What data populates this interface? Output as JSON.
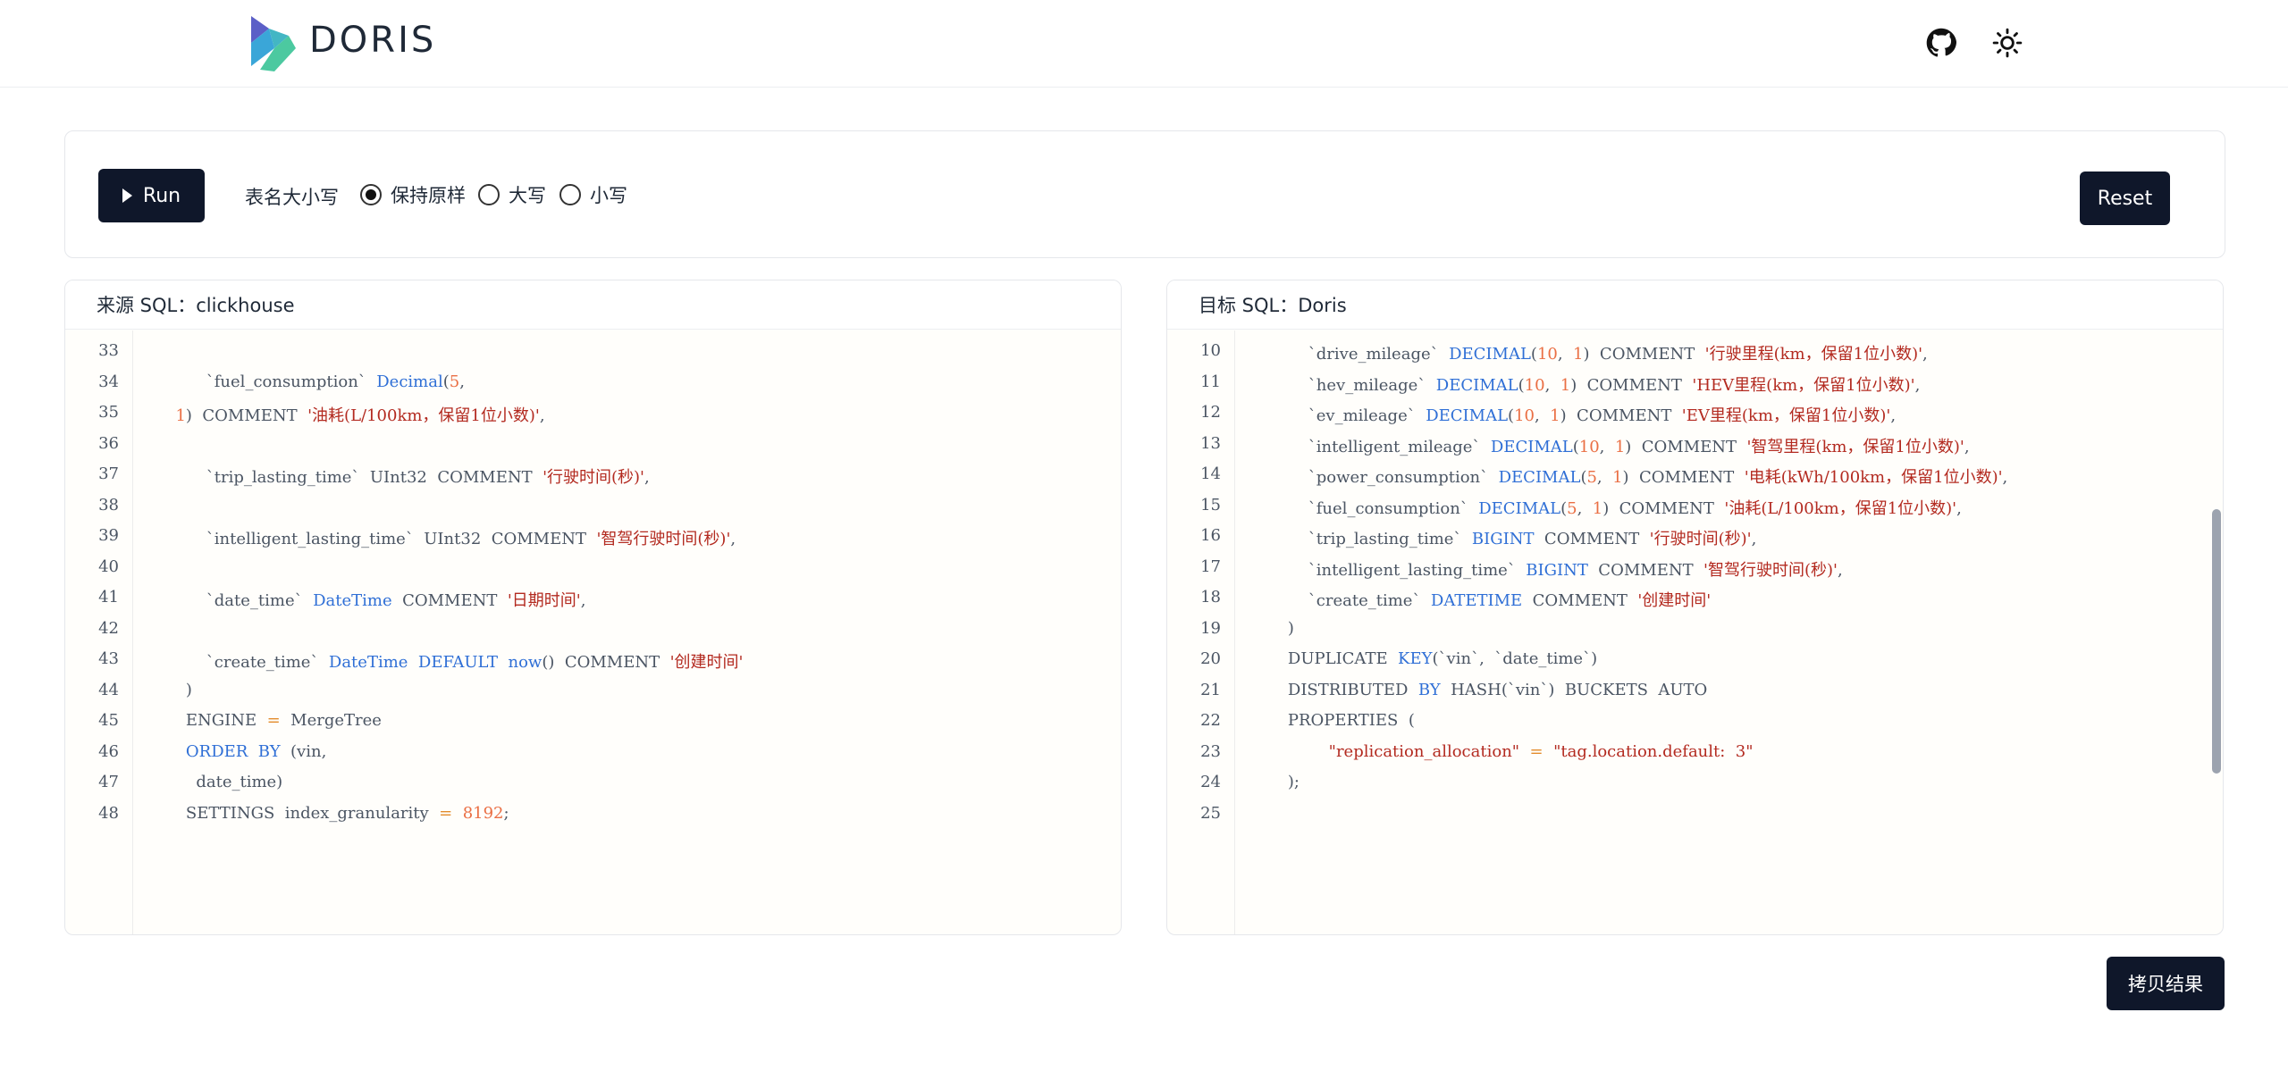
{
  "header": {
    "brand": "DORIS",
    "icons": [
      "github-icon",
      "sun-icon"
    ]
  },
  "toolbar": {
    "run_label": "Run",
    "case_label": "表名大小写",
    "case_options": [
      {
        "label": "保持原样",
        "checked": true
      },
      {
        "label": "大写",
        "checked": false
      },
      {
        "label": "小写",
        "checked": false
      }
    ],
    "reset_label": "Reset"
  },
  "source": {
    "title": "来源 SQL：clickhouse",
    "lines": [
      {
        "n": "33",
        "text": ""
      },
      {
        "n": "34",
        "text": "        `fuel_consumption`  Decimal(5,"
      },
      {
        "n": "35",
        "text": "  1)  COMMENT  '油耗(L/100km，保留1位小数)',"
      },
      {
        "n": "36",
        "text": ""
      },
      {
        "n": "37",
        "text": "        `trip_lasting_time`  UInt32  COMMENT  '行驶时间(秒)',"
      },
      {
        "n": "38",
        "text": ""
      },
      {
        "n": "39",
        "text": "        `intelligent_lasting_time`  UInt32  COMMENT  '智驾行驶时间(秒)',"
      },
      {
        "n": "40",
        "text": ""
      },
      {
        "n": "41",
        "text": "        `date_time`  DateTime  COMMENT  '日期时间',"
      },
      {
        "n": "42",
        "text": ""
      },
      {
        "n": "43",
        "text": "        `create_time`  DateTime  DEFAULT  now()  COMMENT  '创建时间'"
      },
      {
        "n": "44",
        "text": "    )"
      },
      {
        "n": "45",
        "text": "    ENGINE  =  MergeTree"
      },
      {
        "n": "46",
        "text": "    ORDER  BY  (vin,"
      },
      {
        "n": "47",
        "text": "      date_time)"
      },
      {
        "n": "48",
        "text": "    SETTINGS  index_granularity  =  8192;"
      }
    ]
  },
  "target": {
    "title": "目标 SQL：Doris",
    "lines": [
      {
        "n": "10",
        "text": "        `drive_mileage`  DECIMAL(10,  1)  COMMENT  '行驶里程(km，保留1位小数)',"
      },
      {
        "n": "11",
        "text": "        `hev_mileage`  DECIMAL(10,  1)  COMMENT  'HEV里程(km，保留1位小数)',"
      },
      {
        "n": "12",
        "text": "        `ev_mileage`  DECIMAL(10,  1)  COMMENT  'EV里程(km，保留1位小数)',"
      },
      {
        "n": "13",
        "text": "        `intelligent_mileage`  DECIMAL(10,  1)  COMMENT  '智驾里程(km，保留1位小数)',"
      },
      {
        "n": "14",
        "text": "        `power_consumption`  DECIMAL(5,  1)  COMMENT  '电耗(kWh/100km，保留1位小数)',"
      },
      {
        "n": "15",
        "text": "        `fuel_consumption`  DECIMAL(5,  1)  COMMENT  '油耗(L/100km，保留1位小数)',"
      },
      {
        "n": "16",
        "text": "        `trip_lasting_time`  BIGINT  COMMENT  '行驶时间(秒)',"
      },
      {
        "n": "17",
        "text": "        `intelligent_lasting_time`  BIGINT  COMMENT  '智驾行驶时间(秒)',"
      },
      {
        "n": "18",
        "text": "        `create_time`  DATETIME  COMMENT  '创建时间'"
      },
      {
        "n": "19",
        "text": "    )"
      },
      {
        "n": "20",
        "text": "    DUPLICATE  KEY(`vin`,  `date_time`)"
      },
      {
        "n": "21",
        "text": "    DISTRIBUTED  BY  HASH(`vin`)  BUCKETS  AUTO"
      },
      {
        "n": "22",
        "text": "    PROPERTIES  ("
      },
      {
        "n": "23",
        "text": "            \"replication_allocation\"  =  \"tag.location.default:  3\""
      },
      {
        "n": "24",
        "text": "    );"
      },
      {
        "n": "25",
        "text": ""
      }
    ]
  },
  "copy_label": "拷贝结果",
  "colors": {
    "button_bg": "#0f172a",
    "keyword": "#2f6fd6",
    "string": "#b32a20",
    "number": "#ea6f44"
  }
}
